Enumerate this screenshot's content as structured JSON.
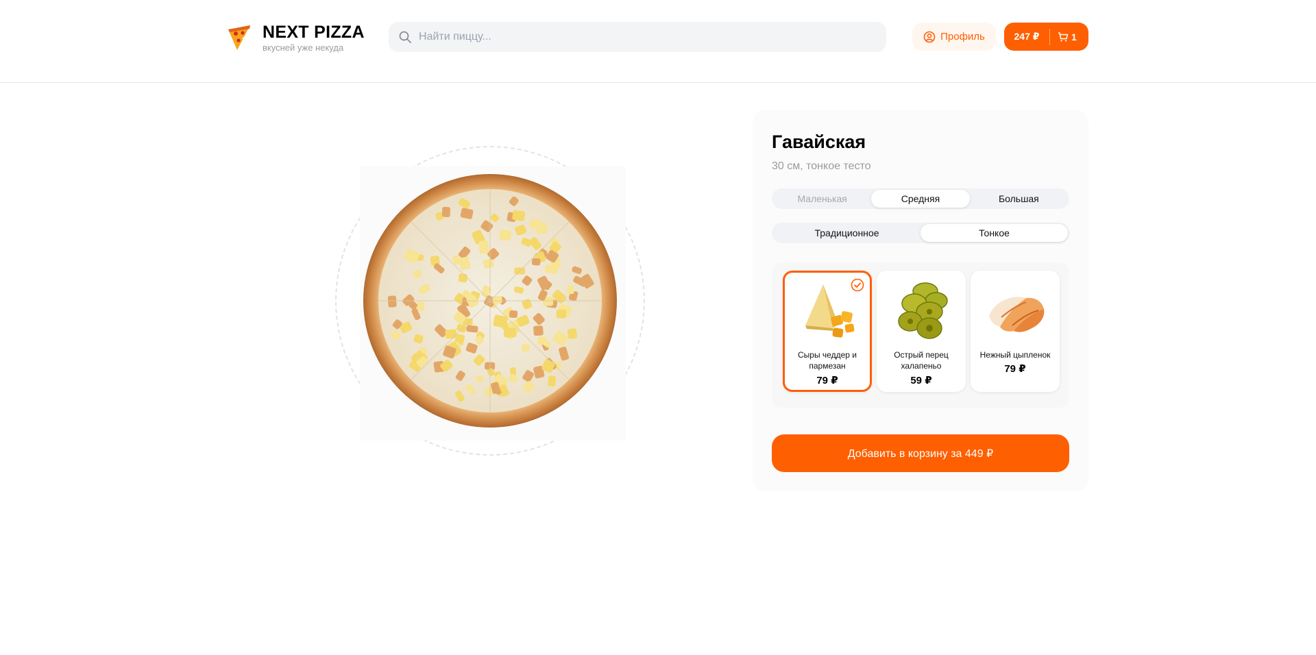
{
  "header": {
    "logo_title": "NEXT PIZZA",
    "logo_subtitle": "вкусней уже некуда",
    "search_placeholder": "Найти пиццу...",
    "profile_label": "Профиль",
    "cart_total": "247 ₽",
    "cart_count": "1",
    "accent_color": "#fe5f00"
  },
  "product": {
    "title": "Гавайская",
    "description": "30 см, тонкое тесто",
    "sizes": [
      {
        "label": "Маленькая",
        "state": "disabled"
      },
      {
        "label": "Средняя",
        "state": "active"
      },
      {
        "label": "Большая",
        "state": "normal"
      }
    ],
    "dough_types": [
      {
        "label": "Традиционное",
        "state": "normal"
      },
      {
        "label": "Тонкое",
        "state": "active"
      }
    ],
    "ingredients": [
      {
        "name": "Сыры чеддер и пармезан",
        "price": "79 ₽",
        "selected": true,
        "icon": "cheese-icon"
      },
      {
        "name": "Острый перец халапеньо",
        "price": "59 ₽",
        "selected": false,
        "icon": "jalapeno-icon"
      },
      {
        "name": "Нежный цыпленок",
        "price": "79 ₽",
        "selected": false,
        "icon": "chicken-icon"
      }
    ],
    "add_button_label": "Добавить в корзину за 449 ₽"
  }
}
